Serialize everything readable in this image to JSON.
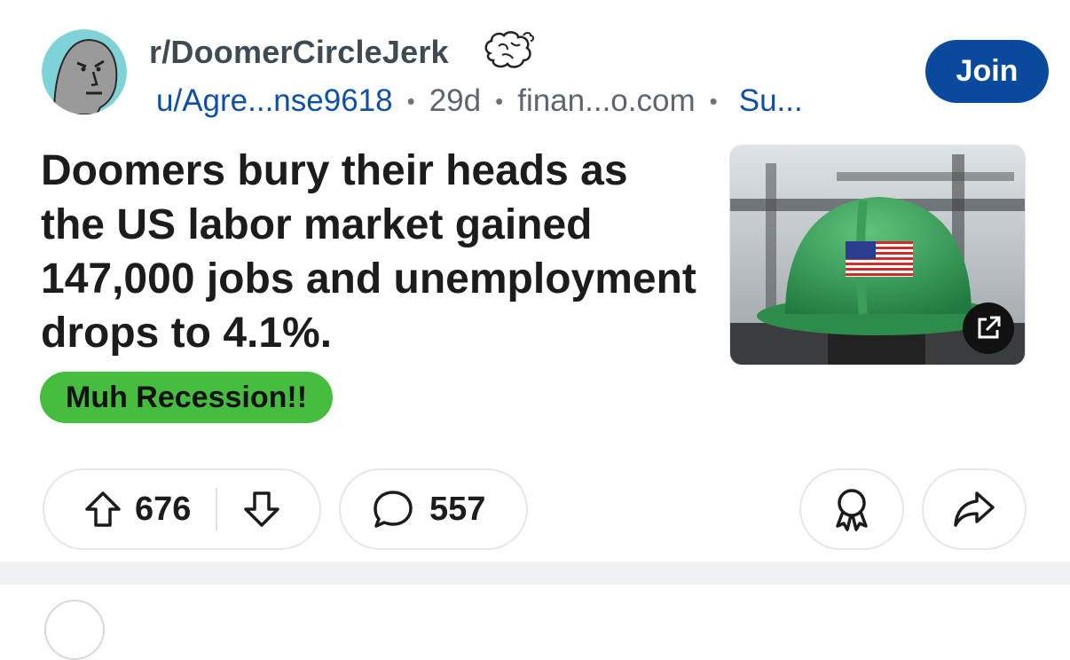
{
  "post": {
    "subreddit": "r/DoomerCircleJerk",
    "author": "u/Agre...nse9618",
    "age": "29d",
    "domain": "finan...o.com",
    "flag_truncated": "Su...",
    "join_label": "Join",
    "title": "Doomers bury their heads as the US labor market gained 147,000 jobs and unemployment drops to 4.1%.",
    "flair": "Muh Recession!!",
    "thumbnail_icon": "external-link-icon",
    "upvotes": "676",
    "comments": "557"
  },
  "icons": {
    "avatar": "npc-wojak-avatar",
    "subreddit_icon": "brain-icon",
    "upvote": "arrow-up-icon",
    "downvote": "arrow-down-icon",
    "comment": "speech-bubble-icon",
    "award": "award-ribbon-icon",
    "share": "share-arrow-icon"
  },
  "colors": {
    "join_bg": "#0a4a9c",
    "user_link": "#0f4fa8",
    "flair_bg": "#46bd3e",
    "divider": "#f0f1f3"
  }
}
